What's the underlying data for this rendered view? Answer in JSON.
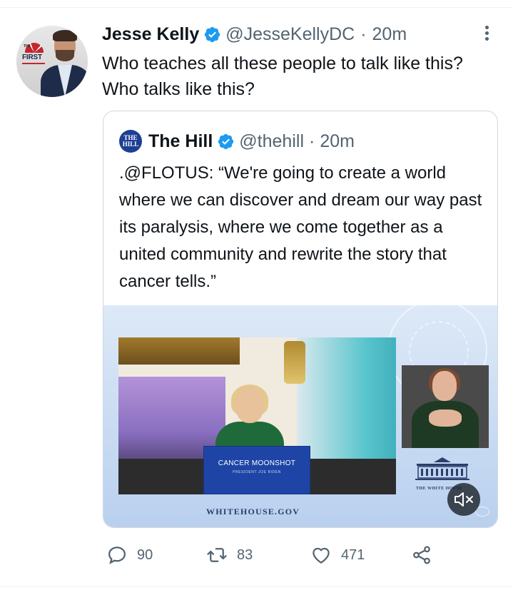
{
  "tweet": {
    "avatar_logo": {
      "the": "THE",
      "first": "FIRST"
    },
    "author_name": "Jesse Kelly",
    "handle": "@JesseKellyDC",
    "separator": "·",
    "time": "20m",
    "text": "Who teaches all these people to talk like this? Who talks like this?",
    "more_icon": "more-vertical-icon",
    "verified_icon": "verified-badge-icon"
  },
  "quoted": {
    "logo_line1": "THE",
    "logo_line2": "HILL",
    "author_name": "The Hill",
    "handle": "@thehill",
    "separator": "·",
    "time": "20m",
    "text": ".@FLOTUS: “We're going to create a world where we can discover and dream our way past its paralysis, where we come together as a united community and rewrite the story that cancer tells.”",
    "media": {
      "podium_label": "CANCER MOONSHOT",
      "podium_sub": "PRESIDENT JOE BIDEN",
      "caption": "THE WHITE HOUSE",
      "site": "WHITEHOUSE.GOV",
      "mute_icon": "volume-muted-icon"
    }
  },
  "actions": {
    "replies": "90",
    "retweets": "83",
    "likes": "471",
    "icons": [
      "reply-icon",
      "retweet-icon",
      "like-icon",
      "share-icon"
    ]
  },
  "colors": {
    "text": "#0f1419",
    "secondary": "#536471",
    "verified": "#1d9bf0",
    "border": "#cfd9de",
    "hill_blue": "#1c3f94"
  }
}
